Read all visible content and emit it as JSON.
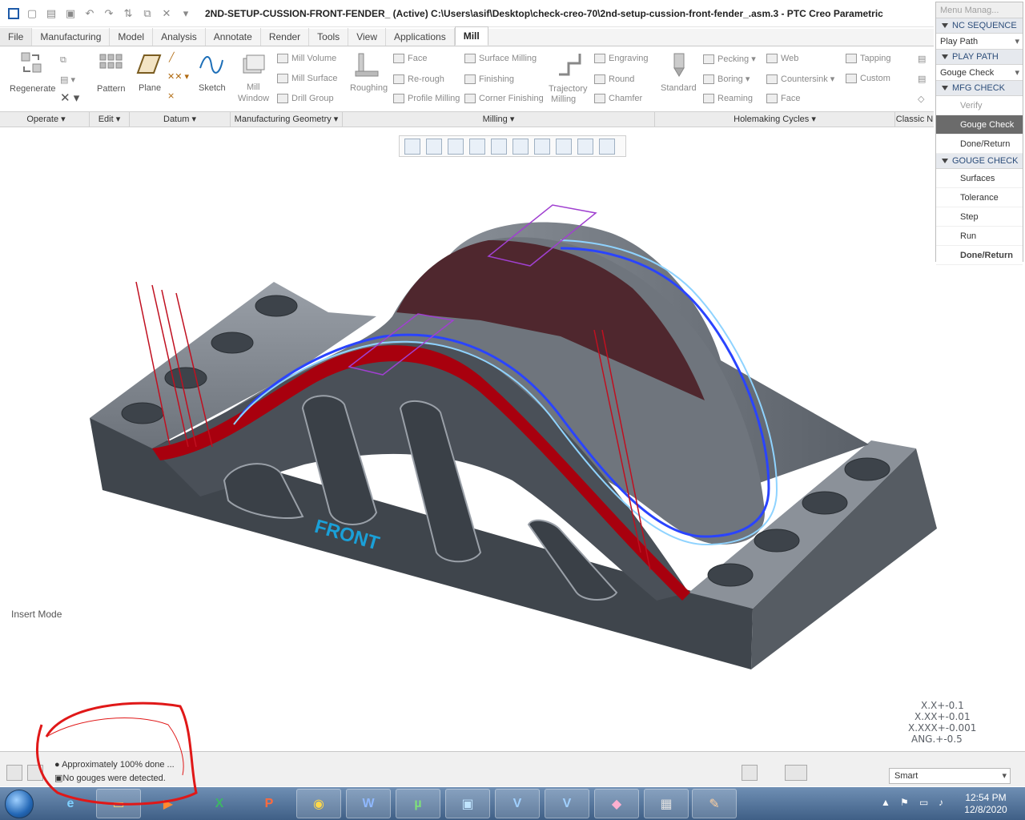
{
  "window": {
    "title": "2ND-SETUP-CUSSION-FRONT-FENDER_ (Active) C:\\Users\\asif\\Desktop\\check-creo-70\\2nd-setup-cussion-front-fender_.asm.3 - PTC Creo Parametric"
  },
  "tabs": [
    "File",
    "Manufacturing",
    "Model",
    "Analysis",
    "Annotate",
    "Render",
    "Tools",
    "View",
    "Applications",
    "Mill"
  ],
  "ribbon": {
    "regenerate": "Regenerate",
    "pattern": "Pattern",
    "plane": "Plane",
    "sketch": "Sketch",
    "mill_window_1": "Mill",
    "mill_window_2": "Window",
    "mill_volume": "Mill Volume",
    "mill_surface": "Mill Surface",
    "drill_group": "Drill Group",
    "roughing": "Roughing",
    "face": "Face",
    "re_rough": "Re-rough",
    "profile_milling": "Profile Milling",
    "surface_milling": "Surface Milling",
    "finishing": "Finishing",
    "corner_finishing": "Corner Finishing",
    "trajectory_1": "Trajectory",
    "trajectory_2": "Milling",
    "engraving": "Engraving",
    "round": "Round",
    "chamfer": "Chamfer",
    "standard": "Standard",
    "pecking": "Pecking",
    "boring": "Boring",
    "reaming": "Reaming",
    "web": "Web",
    "countersink": "Countersink",
    "face2": "Face",
    "tapping": "Tapping",
    "custom": "Custom"
  },
  "groups": {
    "operate": "Operate",
    "edit": "Edit",
    "datum": "Datum",
    "manufacturing_geometry": "Manufacturing Geometry",
    "milling": "Milling",
    "holemaking": "Holemaking Cycles",
    "classic": "Classic N"
  },
  "menu_manager": {
    "title": "Menu Manag...",
    "nc_sequence": "NC SEQUENCE",
    "play_path_dd": "Play Path",
    "play_path_head": "PLAY PATH",
    "gouge_check_dd": "Gouge Check",
    "mfg_check": "MFG CHECK",
    "verify": "Verify",
    "gouge_check": "Gouge Check",
    "done_return": "Done/Return",
    "gouge_check_head": "GOUGE CHECK",
    "surfaces": "Surfaces",
    "tolerance": "Tolerance",
    "step": "Step",
    "run": "Run",
    "done_return2": "Done/Return"
  },
  "graphics": {
    "insert_mode": "Insert Mode",
    "front_label": "FRONT",
    "tolerances": [
      "X.X+-0.1",
      "X.XX+-0.01",
      "X.XXX+-0.001",
      "ANG.+-0.5"
    ]
  },
  "status": {
    "msg1": "Approximately 100% done ...",
    "msg2": "No gouges were detected.",
    "filter": "Smart"
  },
  "taskbar": {
    "time": "12:54 PM",
    "date": "12/8/2020",
    "apps": [
      "IE",
      "Files",
      "Media",
      "Excel",
      "PowerPoint",
      "Chrome",
      "Word",
      "uTorrent",
      "Creo",
      "V",
      "V",
      "App",
      "Network",
      "Paint"
    ]
  },
  "colors": {
    "part_gray": "#4a5058",
    "toolpath_red": "#b00010",
    "toolpath_blue": "#2a44ff",
    "accent": "#1d5aa8",
    "annotation_red": "#e01818"
  }
}
